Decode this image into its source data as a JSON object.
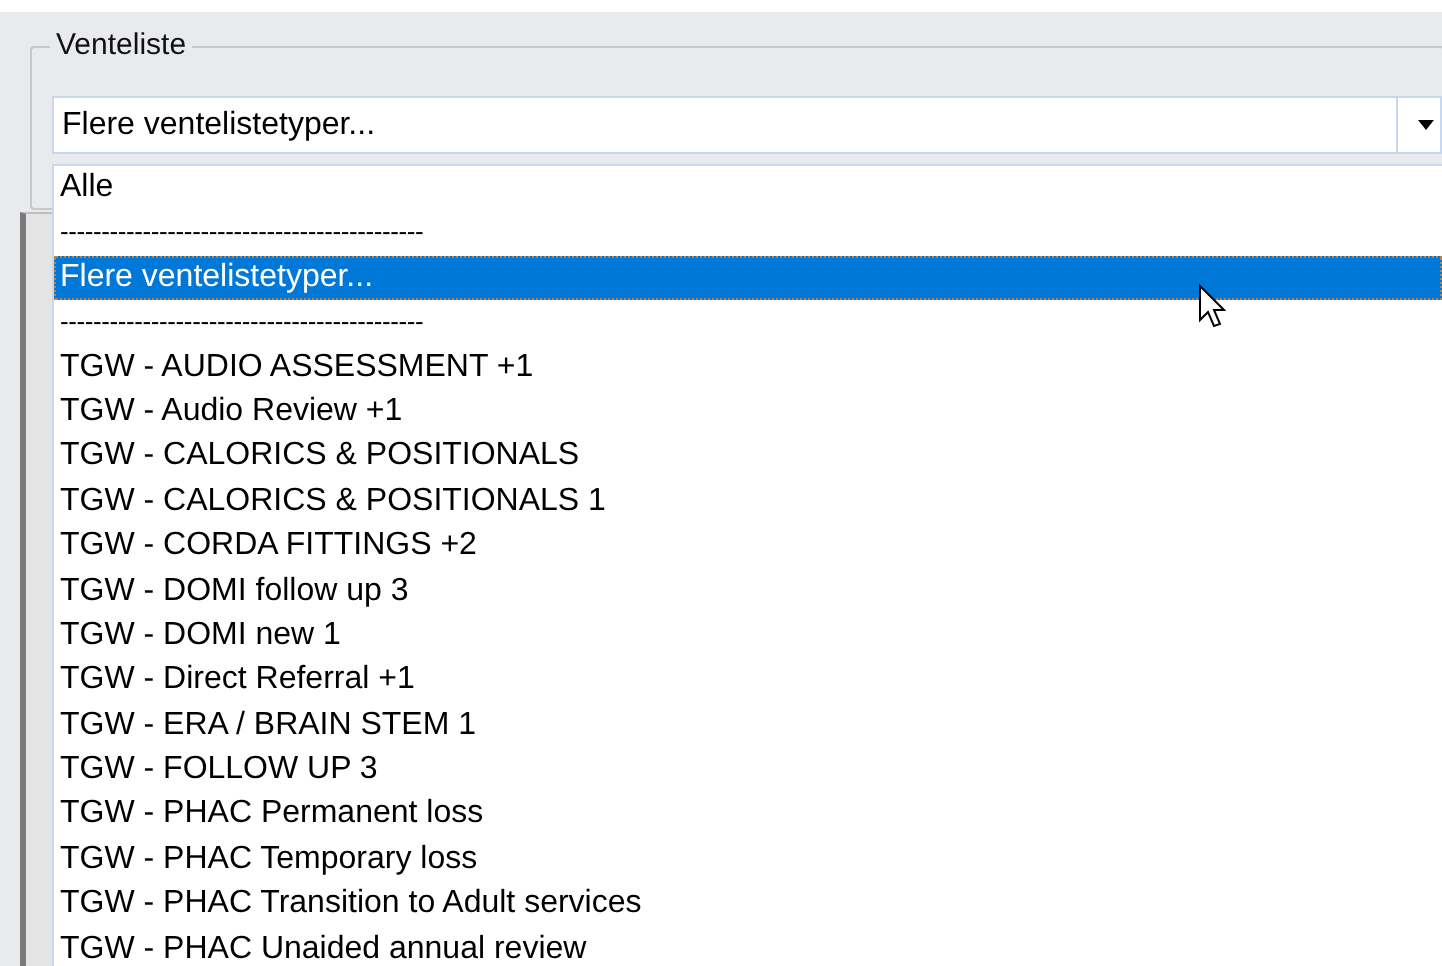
{
  "group": {
    "title": "Venteliste"
  },
  "combo": {
    "value": "Flere ventelistetyper..."
  },
  "dropdown": {
    "items": [
      {
        "kind": "item",
        "label": "Alle",
        "selected": false
      },
      {
        "kind": "separator",
        "label": "--------------------------------------------"
      },
      {
        "kind": "item",
        "label": "Flere ventelistetyper...",
        "selected": true
      },
      {
        "kind": "separator",
        "label": "--------------------------------------------"
      },
      {
        "kind": "item",
        "label": "TGW - AUDIO ASSESSMENT +1",
        "selected": false
      },
      {
        "kind": "item",
        "label": "TGW - Audio Review +1",
        "selected": false
      },
      {
        "kind": "item",
        "label": "TGW - CALORICS & POSITIONALS",
        "selected": false
      },
      {
        "kind": "item",
        "label": "TGW - CALORICS & POSITIONALS 1",
        "selected": false
      },
      {
        "kind": "item",
        "label": "TGW - CORDA FITTINGS +2",
        "selected": false
      },
      {
        "kind": "item",
        "label": "TGW - DOMI follow up 3",
        "selected": false
      },
      {
        "kind": "item",
        "label": "TGW - DOMI new 1",
        "selected": false
      },
      {
        "kind": "item",
        "label": "TGW - Direct Referral +1",
        "selected": false
      },
      {
        "kind": "item",
        "label": "TGW - ERA / BRAIN STEM 1",
        "selected": false
      },
      {
        "kind": "item",
        "label": "TGW - FOLLOW UP 3",
        "selected": false
      },
      {
        "kind": "item",
        "label": "TGW - PHAC Permanent loss",
        "selected": false
      },
      {
        "kind": "item",
        "label": "TGW - PHAC Temporary loss",
        "selected": false
      },
      {
        "kind": "item",
        "label": "TGW - PHAC Transition to Adult services",
        "selected": false
      },
      {
        "kind": "item",
        "label": "TGW - PHAC Unaided annual review",
        "selected": false
      }
    ]
  }
}
